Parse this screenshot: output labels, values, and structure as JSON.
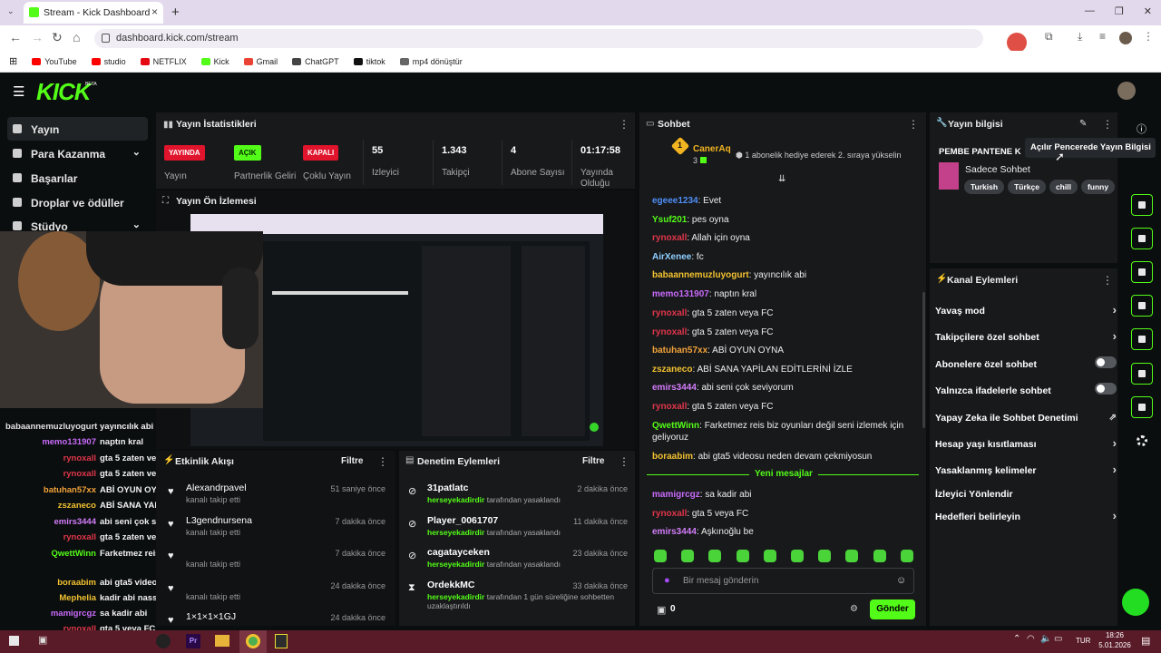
{
  "browser": {
    "tab_title": "Stream - Kick Dashboard",
    "url": "dashboard.kick.com/stream",
    "bookmarks": [
      {
        "label": "YouTube",
        "color": "#ff0000"
      },
      {
        "label": "studio",
        "color": "#ff0000"
      },
      {
        "label": "NETFLIX",
        "color": "#e50914"
      },
      {
        "label": "Kick",
        "color": "#53fc18"
      },
      {
        "label": "Gmail",
        "color": "#ea4335"
      },
      {
        "label": "ChatGPT",
        "color": "#444444"
      },
      {
        "label": "tiktok",
        "color": "#111111"
      },
      {
        "label": "mp4 dönüştür",
        "color": "#666666"
      }
    ]
  },
  "kick": {
    "logo": "KICK",
    "beta": "BETA",
    "accent": "#53fc18"
  },
  "sidebar": {
    "items": [
      {
        "label": "Yayın",
        "icon": "broadcast-icon"
      },
      {
        "label": "Para Kazanma",
        "icon": "money-icon"
      },
      {
        "label": "Başarılar",
        "icon": "trophy-icon"
      },
      {
        "label": "Droplar ve ödüller",
        "icon": "gift-icon"
      },
      {
        "label": "Stüdyo",
        "icon": "studio-icon"
      }
    ]
  },
  "stats": {
    "title": "Yayın İstatistikleri",
    "items": [
      {
        "badge": "YAYINDA",
        "label": "Yayın"
      },
      {
        "badge": "AÇIK",
        "label": "Partnerlik Geliri"
      },
      {
        "badge": "KAPALI",
        "label": "Çoklu Yayın"
      },
      {
        "value": "55",
        "label": "İzleyici"
      },
      {
        "value": "1.343",
        "label": "Takipçi"
      },
      {
        "value": "4",
        "label": "Abone Sayısı"
      },
      {
        "value": "01:17:58",
        "label": "Yayında Olduğu"
      }
    ]
  },
  "preview": {
    "title": "Yayın Ön İzlemesi"
  },
  "overlay_chat": [
    {
      "user": "babaannemuzluyogurt",
      "msg": "yayıncılık abi",
      "color": "#e0e0e0"
    },
    {
      "user": "memo131907",
      "msg": "naptın kral",
      "color": "#c86bfa"
    },
    {
      "user": "rynoxall",
      "msg": "gta 5 zaten veya FC",
      "color": "#e0364a"
    },
    {
      "user": "rynoxall",
      "msg": "gta 5 zaten veya FC",
      "color": "#e0364a"
    },
    {
      "user": "batuhan57xx",
      "msg": "ABİ OYUN OYNA",
      "color": "#f2a33a"
    },
    {
      "user": "zszaneco",
      "msg": "ABİ SANA YAPİLAN EDİTLERİNİ İZLE",
      "color": "#f2c230"
    },
    {
      "user": "emirs3444",
      "msg": "abi seni çok seviyorum",
      "color": "#d27dfa"
    },
    {
      "user": "rynoxall",
      "msg": "gta 5 zaten veya FC",
      "color": "#e0364a"
    },
    {
      "user": "QwettWinn",
      "msg": "Farketmez reis biz oyunları değil seni izlemek için geliyoruz",
      "color": "#53fc18"
    },
    {
      "user": "boraabim",
      "msg": "abi gta5 videosu neden devam çekmiyosun",
      "color": "#f2c230"
    },
    {
      "user": "Mephelia",
      "msg": "kadir abi nassin iyimisin",
      "color": "#f2c230"
    },
    {
      "user": "mamigrcgz",
      "msg": "sa kadir abi",
      "color": "#c86bfa"
    },
    {
      "user": "rynoxall",
      "msg": "gta 5 veya FC",
      "color": "#e0364a"
    },
    {
      "user": "emirs3444",
      "msg": "Aşkınoğlu be",
      "color": "#d27dfa"
    }
  ],
  "activity": {
    "title": "Etkinlik Akışı",
    "filter": "Filtre",
    "rows": [
      {
        "name": "Alexandrpavel",
        "sub": "kanalı takip etti",
        "time": "51 saniye önce"
      },
      {
        "name": "L3gendnursena",
        "sub": "kanalı takip etti",
        "time": "7 dakika önce"
      },
      {
        "name": "",
        "sub": "kanalı takip etti",
        "time": "7 dakika önce"
      },
      {
        "name": "",
        "sub": "kanalı takip etti",
        "time": "24 dakika önce"
      },
      {
        "name": "1×1×1×1GJ",
        "sub": "",
        "time": "24 dakika önce"
      }
    ]
  },
  "moderation": {
    "title": "Denetim Eylemleri",
    "filter": "Filtre",
    "rows": [
      {
        "name": "31patlatc",
        "mod": "herseyekadirdir",
        "sub": "tarafından yasaklandı",
        "time": "2 dakika önce",
        "icon": "ban-icon"
      },
      {
        "name": "Player_0061707",
        "mod": "herseyekadirdir",
        "sub": "tarafından yasaklandı",
        "time": "11 dakika önce",
        "icon": "ban-icon"
      },
      {
        "name": "cagatayceken",
        "mod": "herseyekadirdir",
        "sub": "tarafından yasaklandı",
        "time": "23 dakika önce",
        "icon": "ban-icon"
      },
      {
        "name": "OrdekkMC",
        "mod": "herseyekadirdir",
        "sub": "tarafından 1 gün süreliğine sohbetten uzaklaştırıldı",
        "time": "33 dakika önce",
        "icon": "hourglass-icon"
      }
    ]
  },
  "chat": {
    "title": "Sohbet",
    "pinned_user": "CanerAq",
    "pinned_count": "3",
    "pinned_msg": "1 abonelik hediye ederek 2. sıraya yükselin",
    "messages": [
      {
        "user": "egeee1234",
        "msg": "Evet",
        "color": "#4f8ef7"
      },
      {
        "user": "Ysuf201",
        "msg": "pes oyna",
        "color": "#53fc18"
      },
      {
        "user": "rynoxall",
        "msg": "Allah için oyna",
        "color": "#e0364a"
      },
      {
        "user": "AirXenee",
        "msg": "fc",
        "color": "#8fd1ff"
      },
      {
        "user": "babaannemuzluyogurt",
        "msg": "yayıncılık abi",
        "color": "#f2c230"
      },
      {
        "user": "memo131907",
        "msg": "naptın kral",
        "color": "#c86bfa"
      },
      {
        "user": "rynoxall",
        "msg": "gta 5 zaten veya FC",
        "color": "#e0364a"
      },
      {
        "user": "rynoxall",
        "msg": "gta 5 zaten veya FC",
        "color": "#e0364a"
      },
      {
        "user": "batuhan57xx",
        "msg": "ABİ OYUN OYNA",
        "color": "#f2a33a"
      },
      {
        "user": "zszaneco",
        "msg": "ABİ SANA YAPİLAN EDİTLERİNİ İZLE",
        "color": "#f2c230"
      },
      {
        "user": "emirs3444",
        "msg": "abi seni çok seviyorum",
        "color": "#d27dfa"
      },
      {
        "user": "rynoxall",
        "msg": "gta 5 zaten veya FC",
        "color": "#e0364a"
      },
      {
        "user": "QwettWinn",
        "msg": "Farketmez reis biz oyunları değil seni izlemek için geliyoruz",
        "color": "#53fc18"
      },
      {
        "user": "boraabim",
        "msg": "abi gta5 videosu neden devam çekmiyosun",
        "color": "#f2c230"
      }
    ],
    "divider": "Yeni mesajlar",
    "new_messages": [
      {
        "user": "mamigrcgz",
        "msg": "sa kadir abi",
        "color": "#c86bfa"
      },
      {
        "user": "rynoxall",
        "msg": "gta 5 veya FC",
        "color": "#e0364a"
      },
      {
        "user": "emirs3444",
        "msg": "Aşkınoğlu be",
        "color": "#d27dfa"
      }
    ],
    "input_placeholder": "Bir mesaj gönderin",
    "points": "0",
    "send_label": "Gönder"
  },
  "info": {
    "title": "Yayın bilgisi",
    "tooltip": "Açılır Pencerede Yayın Bilgisi",
    "stream_title": "PEMBE PANTENE K",
    "category": "Sadece Sohbet",
    "tags": [
      "Turkish",
      "Türkçe",
      "chill",
      "funny"
    ]
  },
  "actions": {
    "title": "Kanal Eylemleri",
    "items": [
      {
        "label": "Yavaş mod",
        "control": "chevron"
      },
      {
        "label": "Takipçilere özel sohbet",
        "control": "chevron"
      },
      {
        "label": "Abonelere özel sohbet",
        "control": "toggle"
      },
      {
        "label": "Yalnızca ifadelerle sohbet",
        "control": "toggle"
      },
      {
        "label": "Yapay Zeka ile Sohbet Denetimi",
        "control": "external"
      },
      {
        "label": "Hesap yaşı kısıtlaması",
        "control": "chevron"
      },
      {
        "label": "Yasaklanmış kelimeler",
        "control": "chevron"
      },
      {
        "label": "İzleyici Yönlendir",
        "control": "none"
      },
      {
        "label": "Hedefleri belirleyin",
        "control": "chevron"
      }
    ]
  },
  "taskbar": {
    "lang": "TUR",
    "time": "18:26",
    "date": "5.01.2026"
  }
}
